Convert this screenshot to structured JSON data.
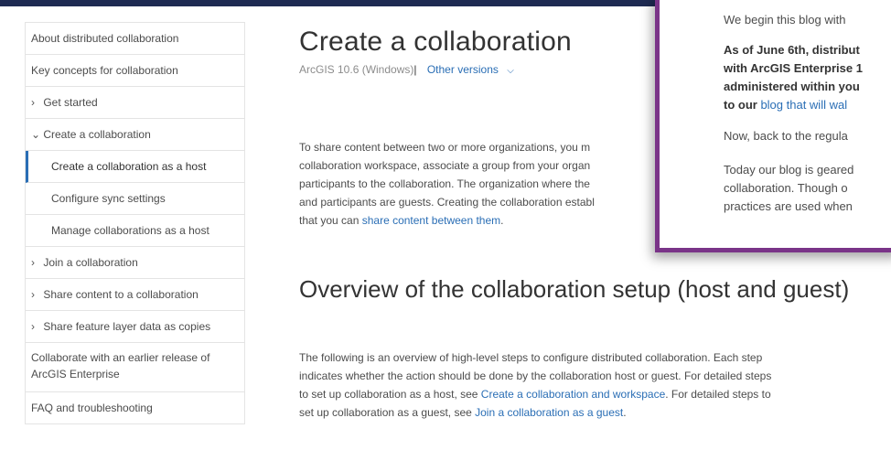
{
  "sidebar": {
    "items": [
      {
        "label": "About distributed collaboration"
      },
      {
        "label": "Key concepts for collaboration"
      },
      {
        "label": "Get started",
        "chevron": "›"
      },
      {
        "label": "Create a collaboration",
        "chevron": "⌄"
      },
      {
        "label": "Create a collaboration as a host"
      },
      {
        "label": "Configure sync settings"
      },
      {
        "label": "Manage collaborations as a host"
      },
      {
        "label": "Join a collaboration",
        "chevron": "›"
      },
      {
        "label": "Share content to a collaboration",
        "chevron": "›"
      },
      {
        "label": "Share feature layer data as copies",
        "chevron": "›"
      },
      {
        "label": "Collaborate with an earlier release of ArcGIS Enterprise"
      },
      {
        "label": "FAQ and troubleshooting"
      }
    ]
  },
  "main": {
    "title": "Create a collaboration",
    "version": "ArcGIS 10.6 (Windows)",
    "version_separator": "|",
    "other_versions": "Other versions",
    "dropdown_icon": "chevron-down-icon",
    "para1": {
      "lines": [
        "To share content between two or more organizations, you m",
        "collaboration workspace, associate a group from your organ",
        "participants to the collaboration. The organization where the",
        "and participants are guests. Creating the collaboration establ"
      ],
      "last_prefix": "that you can ",
      "last_link": "share content between them",
      "last_suffix": "."
    },
    "section_title": "Overview of the collaboration setup (host and guest)",
    "para2": {
      "line1": "The following is an overview of high-level steps to configure distributed collaboration. Each step",
      "line2": "indicates whether the action should be done by the collaboration host or guest. For detailed steps",
      "line3_prefix": "to set up collaboration as a host, see ",
      "line3_link": "Create a collaboration and workspace",
      "line3_suffix": ". For detailed steps to",
      "line4_prefix": "set up collaboration as a guest, see ",
      "line4_link": "Join a collaboration as a guest",
      "line4_suffix": "."
    }
  },
  "overlay": {
    "line1": "We begin this blog with",
    "line2": "As of June 6th, distribut",
    "line3": "with ArcGIS Enterprise 1",
    "line4": "administered within you",
    "line5_prefix": "to our ",
    "line5_link": "blog that will wal",
    "line6": "Now, back to the regula",
    "line7": "Today our blog is geared",
    "line8": "collaboration. Though o",
    "line9": "practices are used when",
    "border_color": "#7a3488"
  }
}
